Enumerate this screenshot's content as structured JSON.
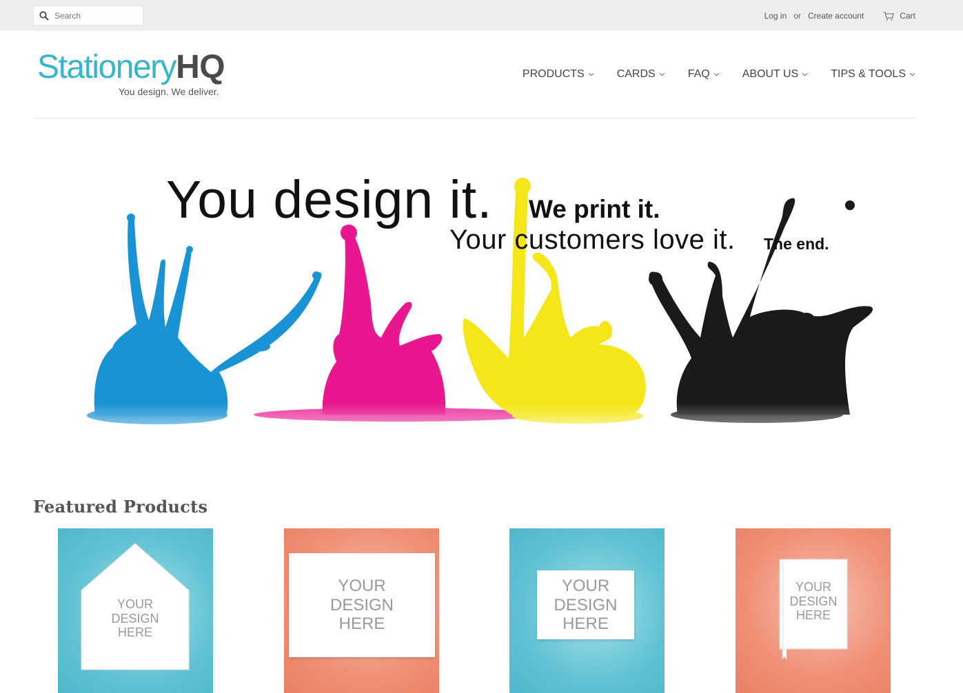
{
  "topbar": {
    "search_placeholder": "Search",
    "login": "Log in",
    "or": "or",
    "create_account": "Create account",
    "cart": "Cart"
  },
  "logo": {
    "name_part1": "Stationery",
    "name_part2": "HQ",
    "tagline": "You design. We deliver."
  },
  "nav": [
    {
      "label": "PRODUCTS"
    },
    {
      "label": "CARDS"
    },
    {
      "label": "FAQ"
    },
    {
      "label": "ABOUT US"
    },
    {
      "label": "TIPS & TOOLS"
    }
  ],
  "hero": {
    "line1": "You design it.",
    "line2": "We print it.",
    "line3": "Your customers love it.",
    "line4": "The end.",
    "splash_colors": [
      "#1a93d4",
      "#e8168f",
      "#f5e61a",
      "#1a1a1a"
    ]
  },
  "featured": {
    "title": "Featured Products",
    "products": [
      {
        "line1": "YOUR",
        "line2": "DESIGN",
        "line3": "HERE",
        "bg": "blue"
      },
      {
        "line1": "YOUR",
        "line2": "DESIGN",
        "line3": "HERE",
        "bg": "coral"
      },
      {
        "line1": "YOUR",
        "line2": "DESIGN",
        "line3": "HERE",
        "bg": "blue"
      },
      {
        "line1": "YOUR",
        "line2": "DESIGN",
        "line3": "HERE",
        "bg": "coral"
      }
    ]
  }
}
